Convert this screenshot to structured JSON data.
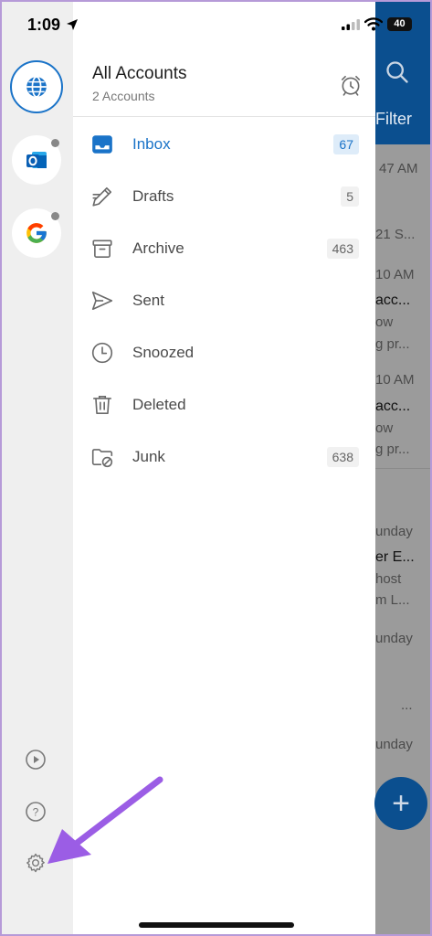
{
  "status_bar": {
    "time": "1:09",
    "battery": "40"
  },
  "rail": {
    "accounts": [
      {
        "name": "all-accounts",
        "icon": "globe-icon"
      },
      {
        "name": "outlook-account",
        "icon": "outlook-icon"
      },
      {
        "name": "google-account",
        "icon": "google-icon"
      }
    ],
    "bottom_icons": [
      "play-icon",
      "help-icon",
      "gear-icon"
    ]
  },
  "drawer": {
    "title": "All Accounts",
    "subtitle": "2 Accounts",
    "folders": [
      {
        "label": "Inbox",
        "count": "67",
        "icon": "inbox-icon"
      },
      {
        "label": "Drafts",
        "count": "5",
        "icon": "pencil-icon"
      },
      {
        "label": "Archive",
        "count": "463",
        "icon": "archive-icon"
      },
      {
        "label": "Sent",
        "count": "",
        "icon": "send-icon"
      },
      {
        "label": "Snoozed",
        "count": "",
        "icon": "clock-icon"
      },
      {
        "label": "Deleted",
        "count": "",
        "icon": "trash-icon"
      },
      {
        "label": "Junk",
        "count": "638",
        "icon": "junk-folder-icon"
      }
    ]
  },
  "behind": {
    "filter": "Filter",
    "texts": [
      "47 AM",
      "21 S...",
      "10 AM",
      "acc...",
      "ow",
      "g pr...",
      "10 AM",
      "acc...",
      "ow",
      "g pr...",
      "unday",
      "er E...",
      "host",
      "m L...",
      "unday",
      "...",
      "unday"
    ]
  },
  "colors": {
    "accent": "#1a73c8",
    "rail_bg": "#efefef",
    "header_blue": "#0b4f8f",
    "arrow": "#9b5de5"
  }
}
